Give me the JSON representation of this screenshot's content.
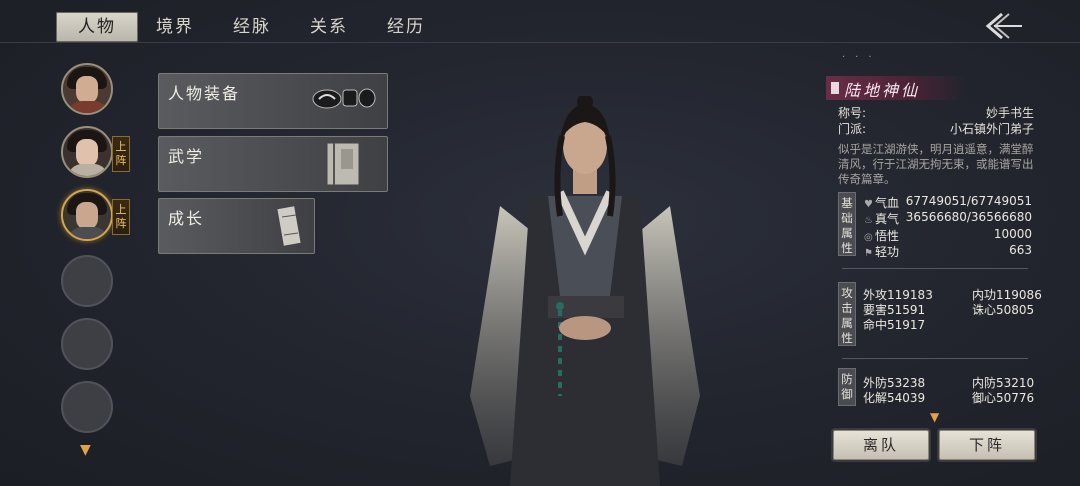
{
  "tabs": [
    "人物",
    "境界",
    "经脉",
    "关系",
    "经历"
  ],
  "active_tab": "人物",
  "portraits": [
    {
      "name": "portrait-1",
      "filled": true,
      "tag": ""
    },
    {
      "name": "portrait-2",
      "filled": true,
      "tag": "上阵"
    },
    {
      "name": "portrait-3",
      "filled": true,
      "tag": "上阵",
      "selected": true
    },
    {
      "name": "portrait-4",
      "filled": false,
      "tag": ""
    },
    {
      "name": "portrait-5",
      "filled": false,
      "tag": ""
    },
    {
      "name": "portrait-6",
      "filled": false,
      "tag": ""
    }
  ],
  "portrait_tags": {
    "tag2": "上\n阵",
    "tag3": "上\n阵"
  },
  "menu": {
    "equipment": "人物装备",
    "martial": "武学",
    "growth": "成长"
  },
  "info": {
    "rank": "陆地神仙",
    "title_label": "称号:",
    "title_value": "妙手书生",
    "faction_label": "门派:",
    "faction_value": "小石镇外门弟子",
    "description": "似乎是江湖游侠，明月逍遥意，满堂醉清风，行于江湖无拘无束，或能谱写出传奇篇章。"
  },
  "sections": {
    "basic": "基础属性",
    "attack": "攻击属性",
    "defense": "防御"
  },
  "basic_stats": {
    "hp_label": "气血",
    "hp_value": "67749051/67749051",
    "qi_label": "真气",
    "qi_value": "36566680/36566680",
    "wisdom_label": "悟性",
    "wisdom_value": "10000",
    "agility_label": "轻功",
    "agility_value": "663"
  },
  "attack_stats": {
    "outer_label": "外攻",
    "outer_value": "119183",
    "inner_label": "内功",
    "inner_value": "119086",
    "crit_label": "要害",
    "crit_value": "51591",
    "focus_label": "诛心",
    "focus_value": "50805",
    "hit_label": "命中",
    "hit_value": "51917"
  },
  "defense_stats": {
    "outer_def_label": "外防",
    "outer_def_value": "53238",
    "inner_def_label": "内防",
    "inner_def_value": "53210",
    "resolve_label": "化解",
    "resolve_value": "54039",
    "guard_label": "御心",
    "guard_value": "50776"
  },
  "buttons": {
    "leave": "离队",
    "unassign": "下阵"
  },
  "colors": {
    "accent_gold": "#d7a546",
    "rank_banner": "#6a2d46"
  }
}
